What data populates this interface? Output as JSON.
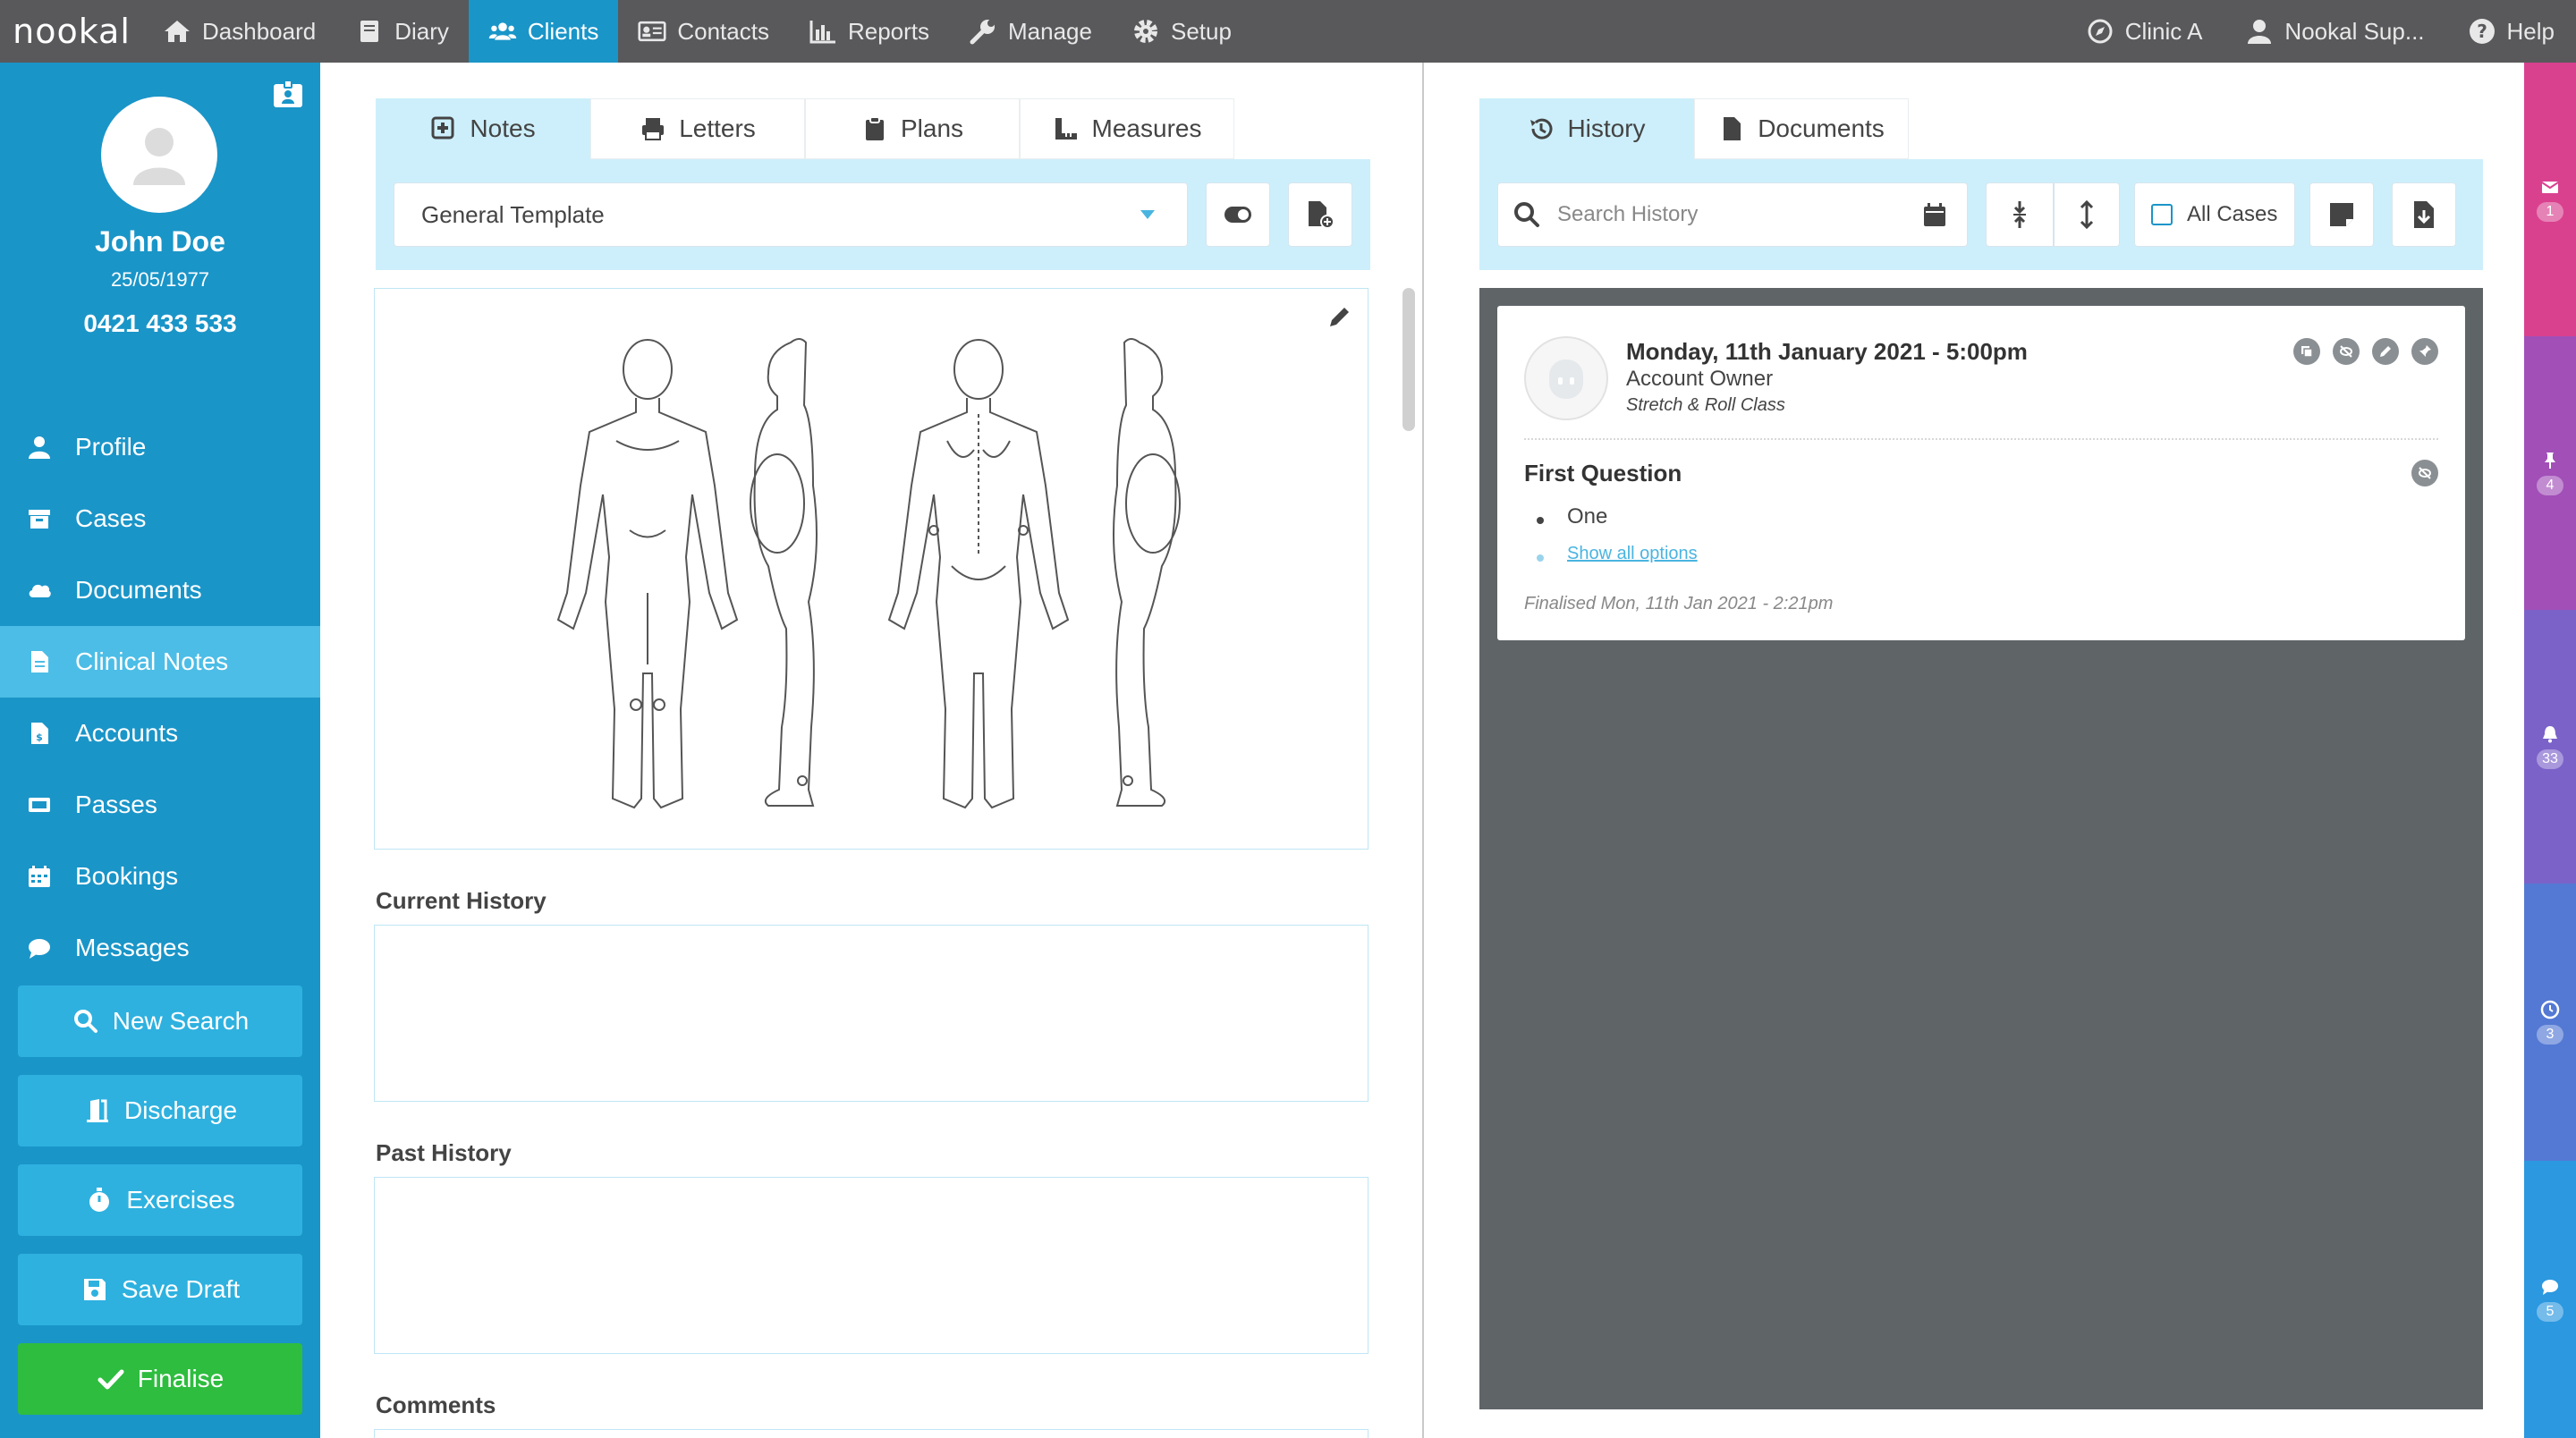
{
  "app": {
    "logo": "nookal"
  },
  "topnav": {
    "items": [
      {
        "label": "Dashboard",
        "icon": "home-icon"
      },
      {
        "label": "Diary",
        "icon": "book-icon"
      },
      {
        "label": "Clients",
        "icon": "users-icon",
        "active": true
      },
      {
        "label": "Contacts",
        "icon": "address-card-icon"
      },
      {
        "label": "Reports",
        "icon": "bar-chart-icon"
      },
      {
        "label": "Manage",
        "icon": "wrench-icon"
      },
      {
        "label": "Setup",
        "icon": "gear-icon"
      }
    ],
    "right": {
      "clinic": "Clinic A",
      "user": "Nookal Sup...",
      "help": "Help"
    }
  },
  "client": {
    "name": "John Doe",
    "dob": "25/05/1977",
    "phone": "0421 433 533"
  },
  "sidebar": {
    "items": [
      {
        "label": "Profile"
      },
      {
        "label": "Cases"
      },
      {
        "label": "Documents"
      },
      {
        "label": "Clinical Notes",
        "active": true
      },
      {
        "label": "Accounts"
      },
      {
        "label": "Passes"
      },
      {
        "label": "Bookings"
      },
      {
        "label": "Messages"
      }
    ],
    "buttons": {
      "new_search": "New Search",
      "discharge": "Discharge",
      "exercises": "Exercises",
      "save_draft": "Save Draft",
      "finalise": "Finalise"
    }
  },
  "notes_panel": {
    "tabs": [
      "Notes",
      "Letters",
      "Plans",
      "Measures"
    ],
    "template": "General Template",
    "fields": {
      "current_history": "Current History",
      "past_history": "Past History",
      "comments": "Comments"
    }
  },
  "history_panel": {
    "tabs": [
      "History",
      "Documents"
    ],
    "search_placeholder": "Search History",
    "all_cases": "All Cases",
    "entry": {
      "date": "Monday, 11th January 2021 - 5:00pm",
      "owner": "Account Owner",
      "class": "Stretch & Roll Class",
      "question": "First Question",
      "answer": "One",
      "show_all": "Show all options",
      "finalised": "Finalised Mon, 11th Jan 2021 - 2:21pm"
    }
  },
  "rail": {
    "badges": [
      "1",
      "4",
      "33",
      "3",
      "5"
    ],
    "colors": [
      "#d9418f",
      "#a24fb8",
      "#7b62c9",
      "#5479d4",
      "#2b98e0"
    ]
  },
  "colors": {
    "primary": "#1a95c8",
    "active_side": "#4cbde6",
    "finalise": "#2ebd3f",
    "topbar": "#59595c",
    "tab_active": "#cdeffb"
  }
}
